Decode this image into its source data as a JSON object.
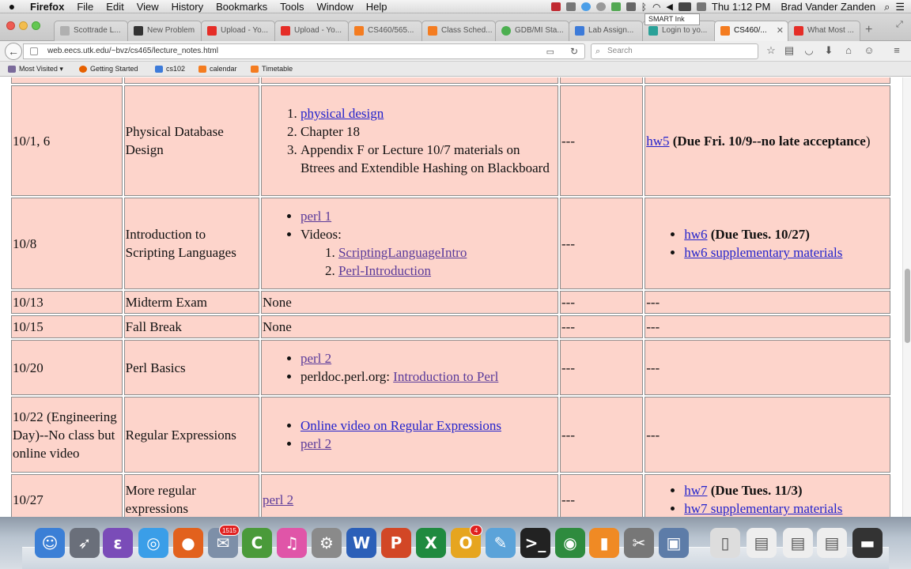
{
  "menubar": {
    "apple": "",
    "items": [
      "Firefox",
      "File",
      "Edit",
      "View",
      "History",
      "Bookmarks",
      "Tools",
      "Window",
      "Help"
    ],
    "clock": "Thu 1:12 PM",
    "user": "Brad Vander Zanden",
    "smart_ink": "SMART Ink"
  },
  "tabs": [
    {
      "label": "Scottrade L...",
      "icon": "page-icon",
      "color": "#b0b0b0"
    },
    {
      "label": "New Problem",
      "icon": "ca-icon",
      "color": "#333333"
    },
    {
      "label": "Upload - Yo...",
      "icon": "youtube-icon",
      "color": "#e52d27"
    },
    {
      "label": "Upload - Yo...",
      "icon": "youtube-icon",
      "color": "#e52d27"
    },
    {
      "label": "CS460/565...",
      "icon": "ut-icon",
      "color": "#f47c20"
    },
    {
      "label": "Class Sched...",
      "icon": "ut-icon",
      "color": "#f47c20"
    },
    {
      "label": "GDB/MI Sta...",
      "icon": "gdb-icon",
      "color": "#4caf50"
    },
    {
      "label": "Lab Assign...",
      "icon": "doc-icon",
      "color": "#3d7bd9"
    },
    {
      "label": "Login to yo...",
      "icon": "ok-icon",
      "color": "#2aa198"
    },
    {
      "label": "CS460/...",
      "icon": "ut-icon",
      "color": "#f47c20",
      "active": true
    },
    {
      "label": "What Most ...",
      "icon": "youtube-icon",
      "color": "#e52d27"
    }
  ],
  "nav": {
    "url": "web.eecs.utk.edu/~bvz/cs465/lecture_notes.html",
    "search_placeholder": "Search"
  },
  "bookmarks": [
    {
      "label": "Most Visited ▾",
      "color": "#7a6a9a"
    },
    {
      "label": "Getting Started",
      "color": "#e66000"
    },
    {
      "label": "cs102",
      "color": "#3d7bd9"
    },
    {
      "label": "calendar",
      "color": "#f47c20"
    },
    {
      "label": "Timetable",
      "color": "#f47c20"
    }
  ],
  "schedule": {
    "rows": [
      {
        "date": "",
        "topic": "",
        "readings": [],
        "lab": "",
        "hw": ""
      },
      {
        "date": "10/1, 6",
        "topic": "Physical Database Design",
        "reading_list": [
          "physical design",
          "Chapter 18",
          "Appendix F or Lecture 10/7 materials on Btrees and Extendible Hashing on Blackboard"
        ],
        "lab": "---",
        "hw_link": "hw5",
        "hw_note": "(Due Fri. 10/9--no late acceptance",
        "hw_tail": ")"
      },
      {
        "date": "10/8",
        "topic": "Introduction to Scripting Languages",
        "reading_link": "perl 1",
        "videos_label": "Videos:",
        "videos": [
          "ScriptingLanguageIntro",
          "Perl-Introduction"
        ],
        "lab": "---",
        "hw_items": [
          {
            "link": "hw6",
            "note": "(Due Tues. 10/27)"
          },
          {
            "link": "hw6 supplementary materials",
            "note": ""
          }
        ]
      },
      {
        "date": "10/13",
        "topic": "Midterm Exam",
        "readings": "None",
        "lab": "---",
        "hw": "---"
      },
      {
        "date": "10/15",
        "topic": "Fall Break",
        "readings": "None",
        "lab": "---",
        "hw": "---"
      },
      {
        "date": "10/20",
        "topic": "Perl Basics",
        "reading_link": "perl 2",
        "perldoc_prefix": "perldoc.perl.org: ",
        "perldoc_link": "Introduction to Perl",
        "lab": "---",
        "hw": "---"
      },
      {
        "date": "10/22 (Engineering Day)--No class but online video",
        "topic": "Regular Expressions",
        "reading_links": [
          "Online video on Regular Expressions",
          "perl 2"
        ],
        "lab": "---",
        "hw": "---"
      },
      {
        "date": "10/27",
        "topic": "More regular expressions",
        "reading_link": "perl 2",
        "lab": "---",
        "hw_items": [
          {
            "link": "hw7",
            "note": "(Due Tues. 11/3)"
          },
          {
            "link": "hw7 supplementary materials",
            "note": ""
          }
        ]
      }
    ]
  },
  "dock": {
    "items": [
      {
        "name": "finder-icon",
        "color": "#3b7fd6",
        "glyph": "☺"
      },
      {
        "name": "launchpad-icon",
        "color": "#6a6f7a",
        "glyph": "➶"
      },
      {
        "name": "emacs-icon",
        "color": "#7a4cb8",
        "glyph": "ε"
      },
      {
        "name": "safari-icon",
        "color": "#3a9ee8",
        "glyph": "◎"
      },
      {
        "name": "firefox-icon",
        "color": "#e2611d",
        "glyph": "●"
      },
      {
        "name": "mail-icon",
        "color": "#7d8fa8",
        "glyph": "✉"
      },
      {
        "name": "camtasia-icon",
        "color": "#4a9a3a",
        "glyph": "C"
      },
      {
        "name": "itunes-icon",
        "color": "#e055a8",
        "glyph": "♫"
      },
      {
        "name": "system-preferences-icon",
        "color": "#8a8a8a",
        "glyph": "⚙"
      },
      {
        "name": "word-icon",
        "color": "#2b5fb8",
        "glyph": "W"
      },
      {
        "name": "powerpoint-icon",
        "color": "#d24726",
        "glyph": "P"
      },
      {
        "name": "excel-icon",
        "color": "#1f8a3f",
        "glyph": "X"
      },
      {
        "name": "outlook-icon",
        "color": "#e6a51f",
        "glyph": "O"
      },
      {
        "name": "textedit-icon",
        "color": "#5ba3d9",
        "glyph": "✎"
      },
      {
        "name": "terminal-icon",
        "color": "#222222",
        "glyph": ">_"
      },
      {
        "name": "tape-icon",
        "color": "#2e8b3e",
        "glyph": "◉"
      },
      {
        "name": "notes-icon",
        "color": "#f08a24",
        "glyph": "▮"
      },
      {
        "name": "utilities-icon",
        "color": "#777777",
        "glyph": "✂"
      },
      {
        "name": "preview-icon",
        "color": "#5d7ca8",
        "glyph": "▣"
      },
      {
        "name": "archive-icon",
        "color": "#dddddd",
        "glyph": "▯"
      },
      {
        "name": "document-icon",
        "color": "#eeeeee",
        "glyph": "▤"
      },
      {
        "name": "document-icon",
        "color": "#eeeeee",
        "glyph": "▤"
      },
      {
        "name": "document-icon",
        "color": "#eeeeee",
        "glyph": "▤"
      },
      {
        "name": "screen-icon",
        "color": "#333333",
        "glyph": "▬"
      },
      {
        "name": "trash-icon",
        "color": "#c9cdd2",
        "glyph": "🗑"
      }
    ],
    "badges": [
      {
        "value": "1515"
      },
      {
        "value": "4"
      }
    ]
  }
}
